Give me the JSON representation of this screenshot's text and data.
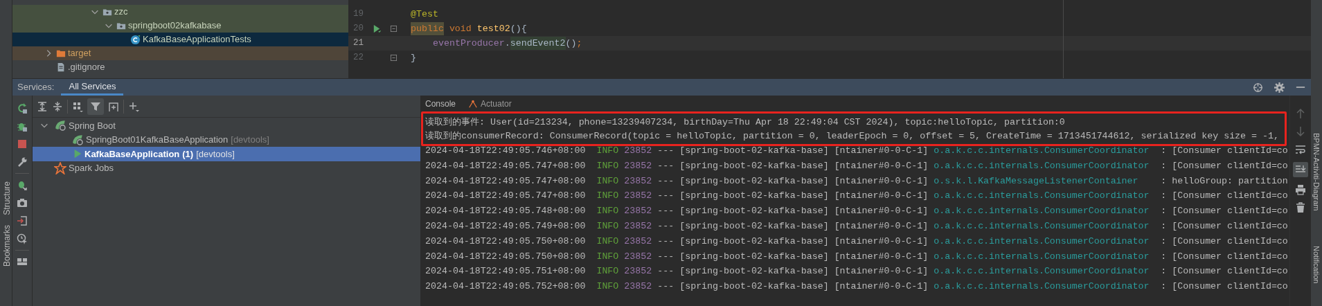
{
  "project_tree": {
    "scrolled_branch": [
      {
        "label": "zzc",
        "kind": "package",
        "test_source": true,
        "expanded": true,
        "selected": false,
        "children": [
          {
            "label": "springboot02kafkabase",
            "kind": "package",
            "test_source": true,
            "expanded": true,
            "selected": false,
            "children": [
              {
                "label": "KafkaBaseApplicationTests",
                "kind": "class",
                "test_source": true,
                "selected": true
              }
            ]
          }
        ]
      }
    ],
    "items": [
      {
        "label": "target",
        "kind": "folder",
        "test_source": false,
        "excluded": true,
        "expanded": false,
        "selected": false
      },
      {
        "label": ".gitignore",
        "kind": "file",
        "test_source": false,
        "excluded": false,
        "selected": false
      }
    ]
  },
  "editor": {
    "lines": [
      {
        "number": "19",
        "tokens": [
          {
            "kind": "annotation",
            "text": "@Test",
            "highlight": false
          }
        ]
      },
      {
        "number": "20",
        "run_icon": true,
        "fold": true,
        "tokens": [
          {
            "kind": "keyword",
            "text": "public",
            "highlight": true
          },
          {
            "kind": "keyword",
            "text": "void",
            "highlight": false
          },
          {
            "kind": "method",
            "text": "test02",
            "highlight": false
          },
          {
            "kind": "plain",
            "text": "(){",
            "highlight": false
          }
        ]
      },
      {
        "number": "21",
        "current": true,
        "indent": true,
        "tokens": [
          {
            "kind": "field",
            "text": "eventProducer",
            "highlight": false
          },
          {
            "kind": "plain",
            "text": ".",
            "highlight": false
          },
          {
            "kind": "plain",
            "text": "sendEvent2",
            "highlight": true
          },
          {
            "kind": "plain",
            "text": "()",
            "highlight": false
          },
          {
            "kind": "keyword",
            "text": ";",
            "highlight": false
          }
        ]
      },
      {
        "number": "22",
        "fold": true,
        "tokens": [
          {
            "kind": "plain",
            "text": "}",
            "highlight": false
          }
        ]
      }
    ]
  },
  "services": {
    "label": "Services:",
    "tabs": [
      {
        "label": "All Services",
        "selected": true
      }
    ],
    "tree": [
      {
        "label": "Spring Boot",
        "kind": "group",
        "expanded": true,
        "selected": false,
        "children": [
          {
            "label": "SpringBoot01KafkaBaseApplication",
            "tag": "[devtools]",
            "kind": "app",
            "selected": false
          },
          {
            "label": "KafkaBaseApplication",
            "count": "(1)",
            "tag": "[devtools]",
            "kind": "running",
            "selected": true
          }
        ]
      },
      {
        "label": "Spark Jobs",
        "kind": "spark",
        "selected": false
      }
    ]
  },
  "console": {
    "tabs": [
      {
        "label": "Console",
        "selected": true
      },
      {
        "label": "Actuator",
        "selected": false
      }
    ],
    "boxed_lines": [
      "读取到的事件: User(id=213234, phone=13239407234, birthDay=Thu Apr 18 22:49:04 CST 2024), topic:helloTopic, partition:0",
      "读取到的consumerRecord: ConsumerRecord(topic = helloTopic, partition = 0, leaderEpoch = 0, offset = 5, CreateTime = 1713451744612, serialized key size = -1,"
    ],
    "log_lines": [
      {
        "timestamp": "2024-04-18T22:49:05.746+08:00",
        "level": "INFO",
        "pid": "23852",
        "sep": "---",
        "app": "[spring-boot-02-kafka-base]",
        "thread": "[ntainer#0-0-C-1]",
        "logger": "o.a.k.c.c.internals.ConsumerCoordinator",
        "message": ": [Consumer clientId=co"
      },
      {
        "timestamp": "2024-04-18T22:49:05.747+08:00",
        "level": "INFO",
        "pid": "23852",
        "sep": "---",
        "app": "[spring-boot-02-kafka-base]",
        "thread": "[ntainer#0-0-C-1]",
        "logger": "o.a.k.c.c.internals.ConsumerCoordinator",
        "message": ": [Consumer clientId=co"
      },
      {
        "timestamp": "2024-04-18T22:49:05.747+08:00",
        "level": "INFO",
        "pid": "23852",
        "sep": "---",
        "app": "[spring-boot-02-kafka-base]",
        "thread": "[ntainer#0-0-C-1]",
        "logger": "o.s.k.l.KafkaMessageListenerContainer",
        "message": ": helloGroup: partition"
      },
      {
        "timestamp": "2024-04-18T22:49:05.747+08:00",
        "level": "INFO",
        "pid": "23852",
        "sep": "---",
        "app": "[spring-boot-02-kafka-base]",
        "thread": "[ntainer#0-0-C-1]",
        "logger": "o.a.k.c.c.internals.ConsumerCoordinator",
        "message": ": [Consumer clientId=co"
      },
      {
        "timestamp": "2024-04-18T22:49:05.748+08:00",
        "level": "INFO",
        "pid": "23852",
        "sep": "---",
        "app": "[spring-boot-02-kafka-base]",
        "thread": "[ntainer#0-0-C-1]",
        "logger": "o.a.k.c.c.internals.ConsumerCoordinator",
        "message": ": [Consumer clientId=co"
      },
      {
        "timestamp": "2024-04-18T22:49:05.749+08:00",
        "level": "INFO",
        "pid": "23852",
        "sep": "---",
        "app": "[spring-boot-02-kafka-base]",
        "thread": "[ntainer#0-0-C-1]",
        "logger": "o.a.k.c.c.internals.ConsumerCoordinator",
        "message": ": [Consumer clientId=co"
      },
      {
        "timestamp": "2024-04-18T22:49:05.750+08:00",
        "level": "INFO",
        "pid": "23852",
        "sep": "---",
        "app": "[spring-boot-02-kafka-base]",
        "thread": "[ntainer#0-0-C-1]",
        "logger": "o.a.k.c.c.internals.ConsumerCoordinator",
        "message": ": [Consumer clientId=co"
      },
      {
        "timestamp": "2024-04-18T22:49:05.750+08:00",
        "level": "INFO",
        "pid": "23852",
        "sep": "---",
        "app": "[spring-boot-02-kafka-base]",
        "thread": "[ntainer#0-0-C-1]",
        "logger": "o.a.k.c.c.internals.ConsumerCoordinator",
        "message": ": [Consumer clientId=co"
      },
      {
        "timestamp": "2024-04-18T22:49:05.751+08:00",
        "level": "INFO",
        "pid": "23852",
        "sep": "---",
        "app": "[spring-boot-02-kafka-base]",
        "thread": "[ntainer#0-0-C-1]",
        "logger": "o.a.k.c.c.internals.ConsumerCoordinator",
        "message": ": [Consumer clientId=co"
      },
      {
        "timestamp": "2024-04-18T22:49:05.752+08:00",
        "level": "INFO",
        "pid": "23852",
        "sep": "---",
        "app": "[spring-boot-02-kafka-base]",
        "thread": "[ntainer#0-0-C-1]",
        "logger": "o.a.k.c.c.internals.ConsumerCoordinator",
        "message": ": [Consumer clientId=co"
      }
    ]
  },
  "left_stripe": [
    {
      "label": "Structure"
    },
    {
      "label": "Bookmarks"
    }
  ],
  "right_stripe": [
    {
      "label": "BPMN-Activiti-Diagram"
    },
    {
      "label": "Notification"
    }
  ]
}
